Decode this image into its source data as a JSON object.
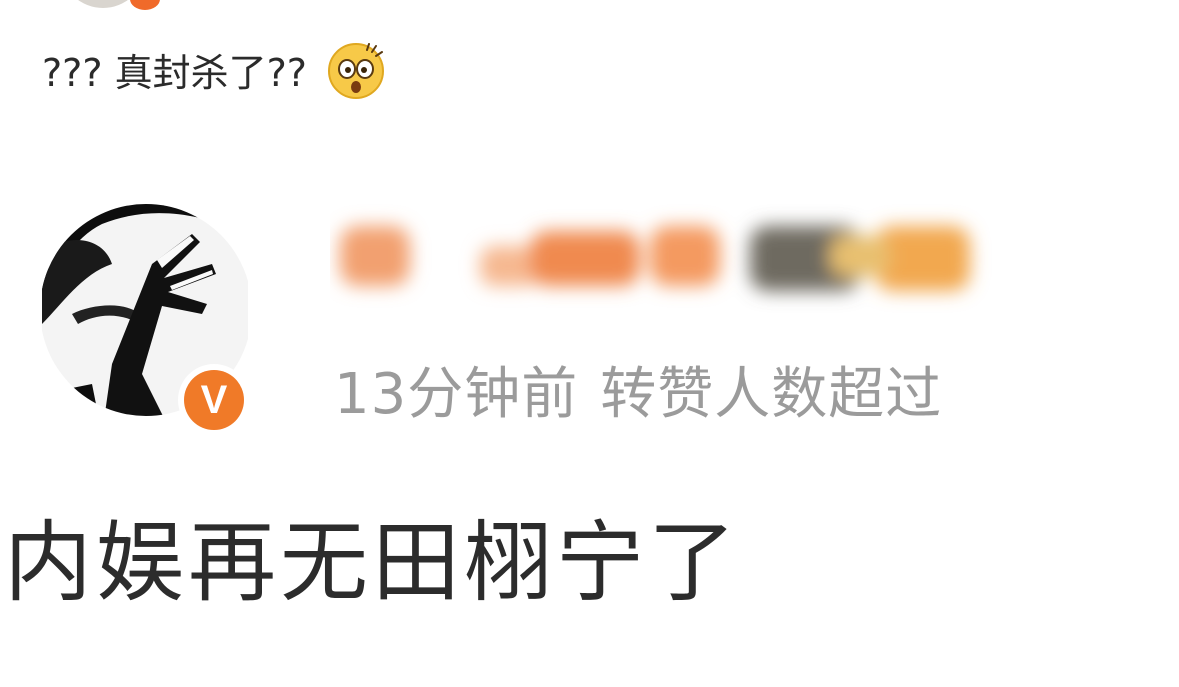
{
  "comment": {
    "text": "??? 真封杀了??",
    "emoji_icon": "shocked-face-emoji"
  },
  "screenshot_post": {
    "author_name": "",
    "verified_badge": "V",
    "time_ago": "13分钟前",
    "status": "转赞人数超过",
    "content": "内娱再无田栩宁了"
  },
  "colors": {
    "verified_orange": "#f07a28",
    "meta_gray": "#9b9b9b",
    "text_dark": "#2c2c2c"
  }
}
